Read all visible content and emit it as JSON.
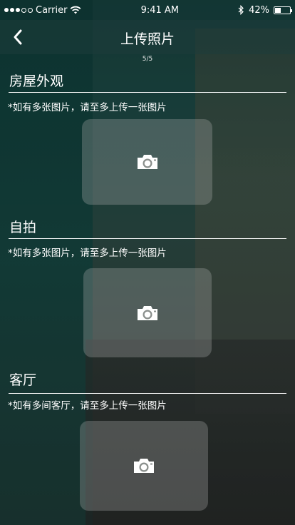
{
  "status_bar": {
    "carrier": "Carrier",
    "time": "9:41 AM",
    "battery": "42%",
    "battery_level": 0.42
  },
  "nav": {
    "title": "上传照片",
    "counter": "5/5"
  },
  "sections": [
    {
      "title": "房屋外观",
      "hint": "*如有多张图片，请至多上传一张图片",
      "icon": "camera-icon"
    },
    {
      "title": "自拍",
      "hint": "*如有多张图片，请至多上传一张图片",
      "icon": "camera-icon"
    },
    {
      "title": "客厅",
      "hint": "*如有多间客厅，请至多上传一张图片",
      "icon": "camera-icon"
    }
  ]
}
